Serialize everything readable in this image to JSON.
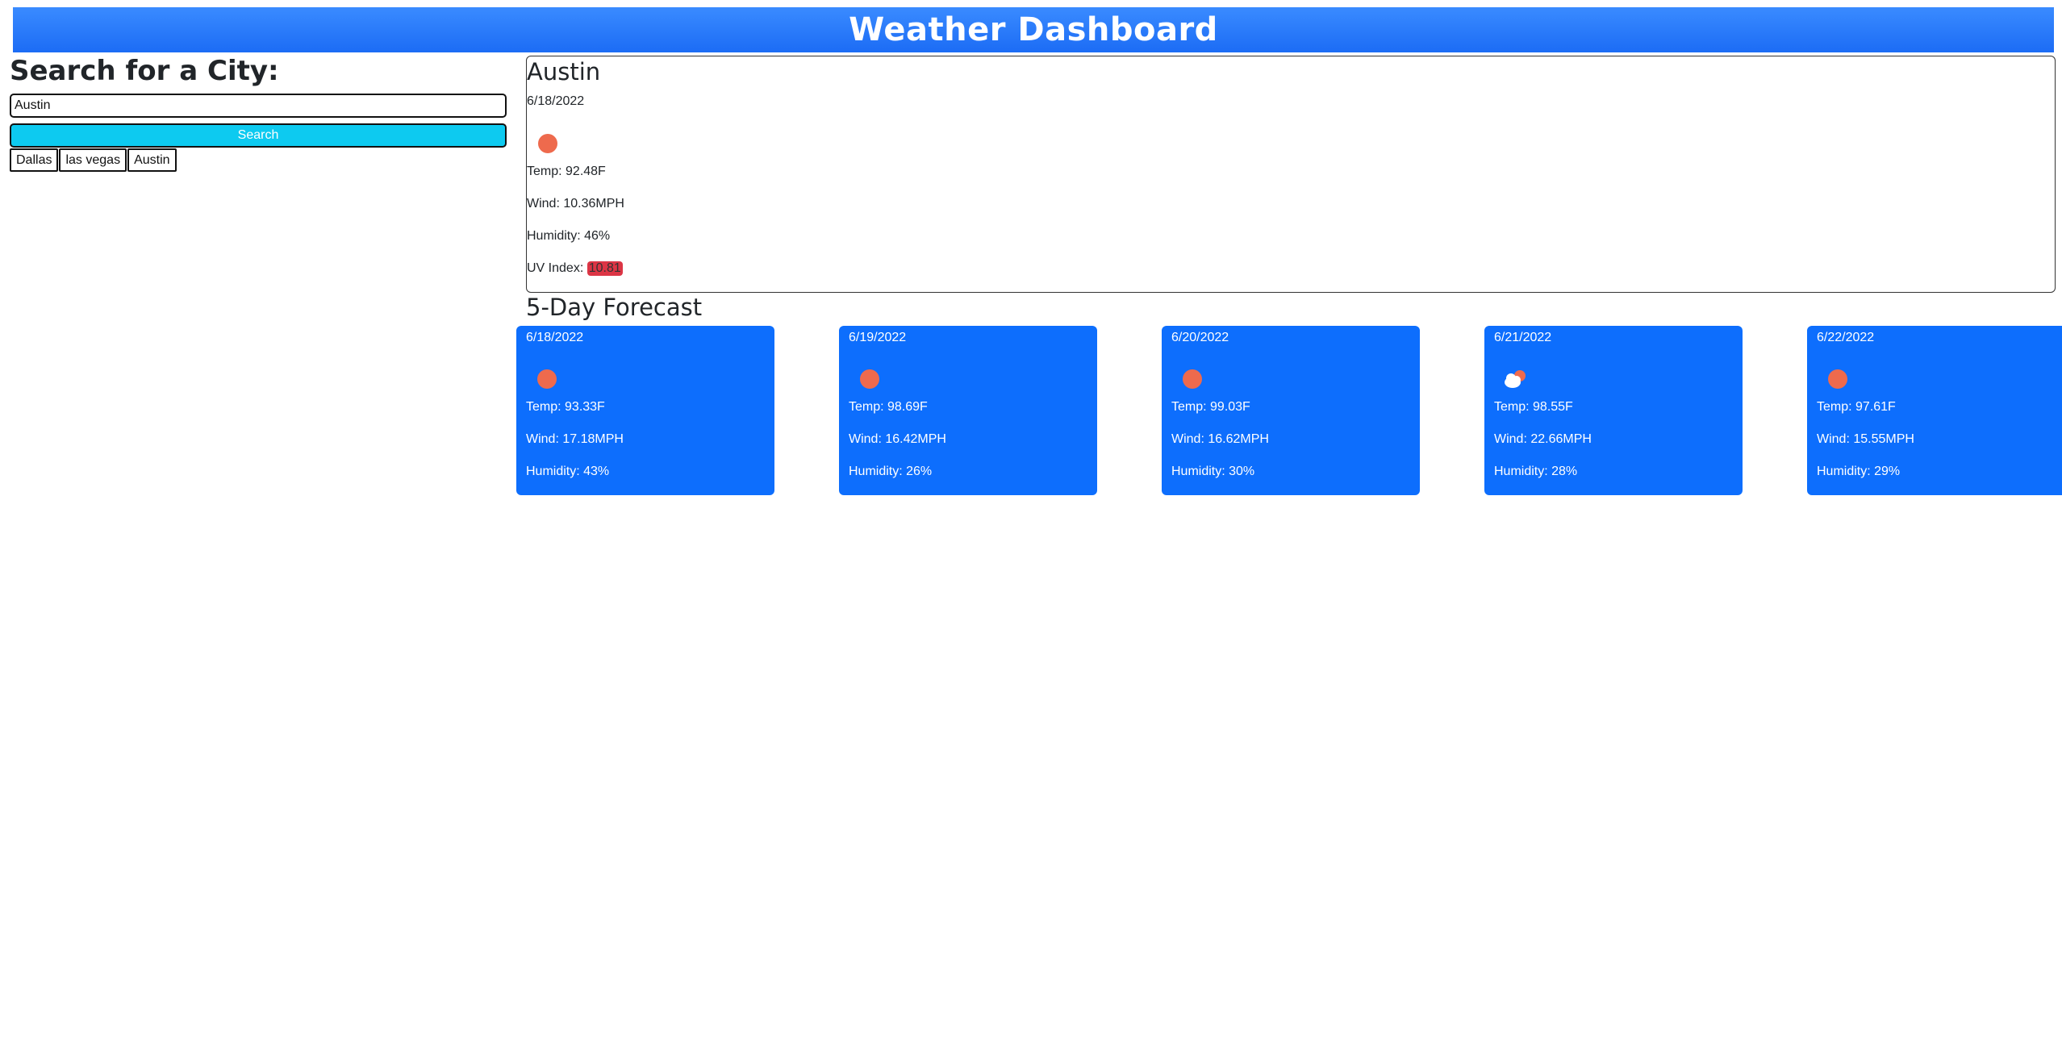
{
  "header": {
    "title": "Weather Dashboard"
  },
  "search": {
    "heading": "Search for a City:",
    "input_value": "Austin",
    "button_label": "Search",
    "history": [
      "Dallas",
      "las vegas",
      "Austin"
    ]
  },
  "current": {
    "city": "Austin",
    "date": "6/18/2022",
    "icon": "sun-icon",
    "temp": "Temp: 92.48F",
    "wind": "Wind: 10.36MPH",
    "humidity": "Humidity: 46%",
    "uv_label": "UV Index: ",
    "uv_value": "10.81"
  },
  "forecast": {
    "heading": "5-Day Forecast",
    "days": [
      {
        "date": "6/18/2022",
        "icon": "sun-icon",
        "temp": "Temp: 93.33F",
        "wind": "Wind: 17.18MPH",
        "humidity": "Humidity: 43%"
      },
      {
        "date": "6/19/2022",
        "icon": "sun-icon",
        "temp": "Temp: 98.69F",
        "wind": "Wind: 16.42MPH",
        "humidity": "Humidity: 26%"
      },
      {
        "date": "6/20/2022",
        "icon": "sun-icon",
        "temp": "Temp: 99.03F",
        "wind": "Wind: 16.62MPH",
        "humidity": "Humidity: 30%"
      },
      {
        "date": "6/21/2022",
        "icon": "cloud-sun-icon",
        "temp": "Temp: 98.55F",
        "wind": "Wind: 22.66MPH",
        "humidity": "Humidity: 28%"
      },
      {
        "date": "6/22/2022",
        "icon": "sun-icon",
        "temp": "Temp: 97.61F",
        "wind": "Wind: 15.55MPH",
        "humidity": "Humidity: 29%"
      }
    ]
  },
  "colors": {
    "header": "#1c6cf5",
    "card": "#0d6efd",
    "search_button": "#0dcaf0",
    "sun": "#ee6a4d",
    "uv_badge": "#dc3545"
  }
}
